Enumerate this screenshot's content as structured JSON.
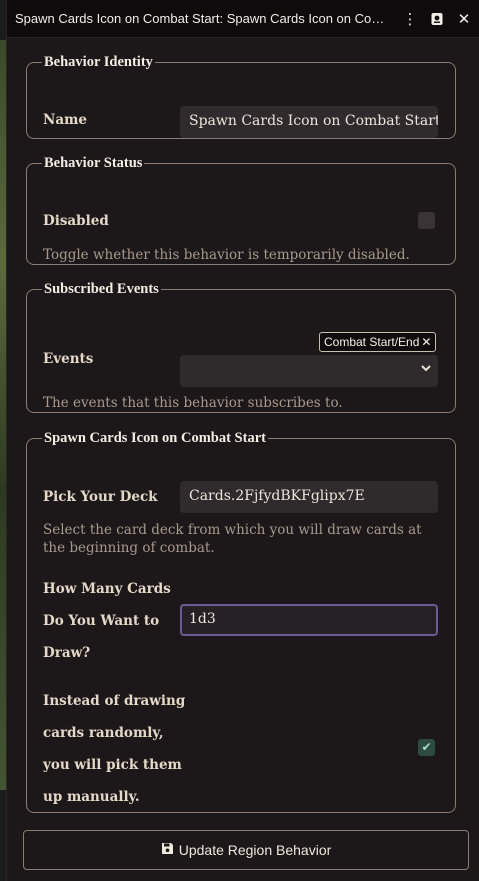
{
  "window": {
    "title": "Spawn Cards Icon on Combat Start: Spawn Cards Icon on Combat Start",
    "icons": [
      "kebab-menu-icon",
      "journal-icon",
      "close-icon"
    ]
  },
  "identity": {
    "legend": "Behavior Identity",
    "name_label": "Name",
    "name_value": "Spawn Cards Icon on Combat Start"
  },
  "status": {
    "legend": "Behavior Status",
    "disabled_label": "Disabled",
    "disabled_checked": false,
    "hint": "Toggle whether this behavior is temporarily disabled."
  },
  "events": {
    "legend": "Subscribed Events",
    "label": "Events",
    "selected_tag": "Combat Start/End",
    "tag_remove": "✕",
    "select_value": "",
    "hint": "The events that this behavior subscribes to."
  },
  "spawn": {
    "legend": "Spawn Cards Icon on Combat Start",
    "deck_label": "Pick Your Deck",
    "deck_value": "Cards.2FjfydBKFglipx7E",
    "deck_hint": "Select the card deck from which you will draw cards at the beginning of combat.",
    "count_label_lines": [
      "How Many Cards",
      "Do You Want to",
      "Draw?"
    ],
    "count_value": "1d3",
    "manual_label_lines": [
      "Instead of drawing",
      "cards randomly,",
      "you will pick them",
      "up manually."
    ],
    "manual_checked": true
  },
  "footer": {
    "update_label": "Update Region Behavior",
    "update_icon": "save-icon"
  }
}
